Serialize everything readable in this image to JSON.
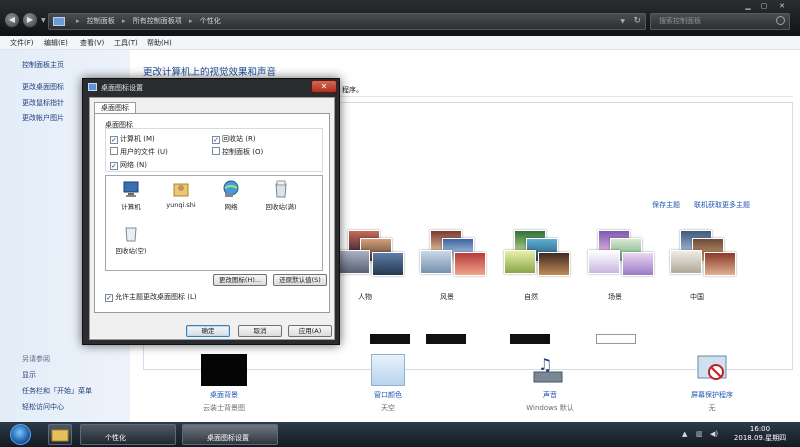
{
  "address_bar": {
    "crumbs": [
      "控制面板",
      "所有控制面板项",
      "个性化"
    ],
    "search_placeholder": "搜索控制面板"
  },
  "menu": [
    "文件(F)",
    "编辑(E)",
    "查看(V)",
    "工具(T)",
    "帮助(H)"
  ],
  "sidebar": {
    "links": [
      "控制面板主页",
      "更改桌面图标",
      "更改鼠标指针",
      "更改帐户图片"
    ],
    "see_also_heading": "另请参阅",
    "see_also": [
      "显示",
      "任务栏和「开始」菜单",
      "轻松访问中心"
    ]
  },
  "main": {
    "title": "更改计算机上的视觉效果和声音",
    "desc_tail": "程序。",
    "save_theme": "保存主题",
    "get_more": "联机获取更多主题",
    "themes": [
      "人物",
      "风景",
      "自然",
      "场景",
      "中国"
    ],
    "items": [
      {
        "label": "桌面背景",
        "value": "云装士背景图"
      },
      {
        "label": "窗口颜色",
        "value": "天空"
      },
      {
        "label": "声音",
        "value": "Windows 默认"
      },
      {
        "label": "屏幕保护程序",
        "value": "无"
      }
    ]
  },
  "dialog": {
    "title": "桌面图标设置",
    "tab": "桌面图标",
    "group_label": "桌面图标",
    "checkboxes": [
      {
        "label": "计算机 (M)",
        "checked": true
      },
      {
        "label": "回收站 (R)",
        "checked": true
      },
      {
        "label": "用户的文件 (U)",
        "checked": false
      },
      {
        "label": "控制面板 (O)",
        "checked": false
      },
      {
        "label": "网络 (N)",
        "checked": true
      }
    ],
    "icons": [
      "计算机",
      "yunqi.shi",
      "网络",
      "回收站(满)",
      "回收站(空)"
    ],
    "change_icon": "更改图标(H)...",
    "restore_default": "还原默认值(S)",
    "allow_themes": "允许主题更改桌面图标 (L)",
    "ok": "确定",
    "cancel": "取消",
    "apply": "应用(A)"
  },
  "taskbar": {
    "buttons": [
      "个性化",
      "桌面图标设置"
    ],
    "time": "16:00",
    "date": "2018.09.星期四"
  }
}
